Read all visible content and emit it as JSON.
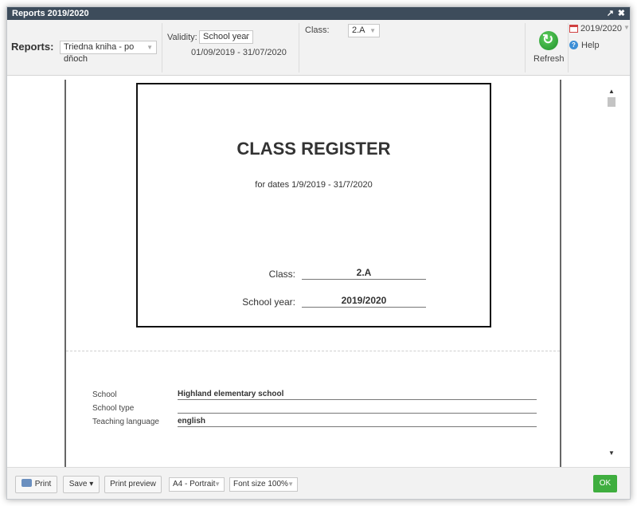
{
  "window": {
    "title": "Reports 2019/2020",
    "maximize_glyph": "↗",
    "close_glyph": "✖"
  },
  "toolbar": {
    "reports_label": "Reports:",
    "report_select": "Triedna kniha - po dňoch",
    "validity_label": "Validity:",
    "validity_select": "School year",
    "validity_dates": "01/09/2019 - 31/07/2020",
    "class_label": "Class:",
    "class_select": "2.A",
    "refresh_label": "Refresh",
    "year_label": "2019/2020",
    "help_label": "Help",
    "dropdown_arrow": "▼"
  },
  "document": {
    "cover_title": "CLASS REGISTER",
    "cover_subtitle": "for dates 1/9/2019 - 31/7/2020",
    "class_label": "Class:",
    "class_value": "2.A",
    "year_label": "School year:",
    "year_value": "2019/2020",
    "info": [
      {
        "label": "School",
        "value": "Highland elementary school"
      },
      {
        "label": "School type",
        "value": ""
      },
      {
        "label": "Teaching language",
        "value": "english"
      }
    ]
  },
  "scrollbar": {
    "up_glyph": "▲",
    "down_glyph": "▼"
  },
  "footer": {
    "print_label": "Print",
    "save_label": "Save ▾",
    "preview_label": "Print preview",
    "paper_select": "A4 - Portrait",
    "font_select": "Font size 100%",
    "ok_label": "OK"
  }
}
